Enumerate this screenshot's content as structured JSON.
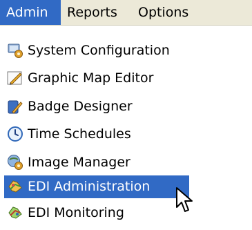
{
  "menubar": {
    "items": [
      {
        "label": "Admin"
      },
      {
        "label": "Reports"
      },
      {
        "label": "Options"
      }
    ]
  },
  "admin_menu": {
    "items": [
      {
        "label": "System Configuration",
        "icon": "system-configuration-icon"
      },
      {
        "label": "Graphic Map Editor",
        "icon": "map-editor-icon"
      },
      {
        "label": "Badge Designer",
        "icon": "badge-designer-icon"
      },
      {
        "label": "Time Schedules",
        "icon": "clock-icon"
      },
      {
        "label": "Image Manager",
        "icon": "image-manager-icon"
      },
      {
        "label": "EDI Administration",
        "icon": "edi-administration-icon"
      },
      {
        "label": "EDI Monitoring",
        "icon": "edi-monitoring-icon"
      }
    ]
  },
  "colors": {
    "highlight": "#316ac5",
    "menubar_bg": "#ece9d8"
  }
}
